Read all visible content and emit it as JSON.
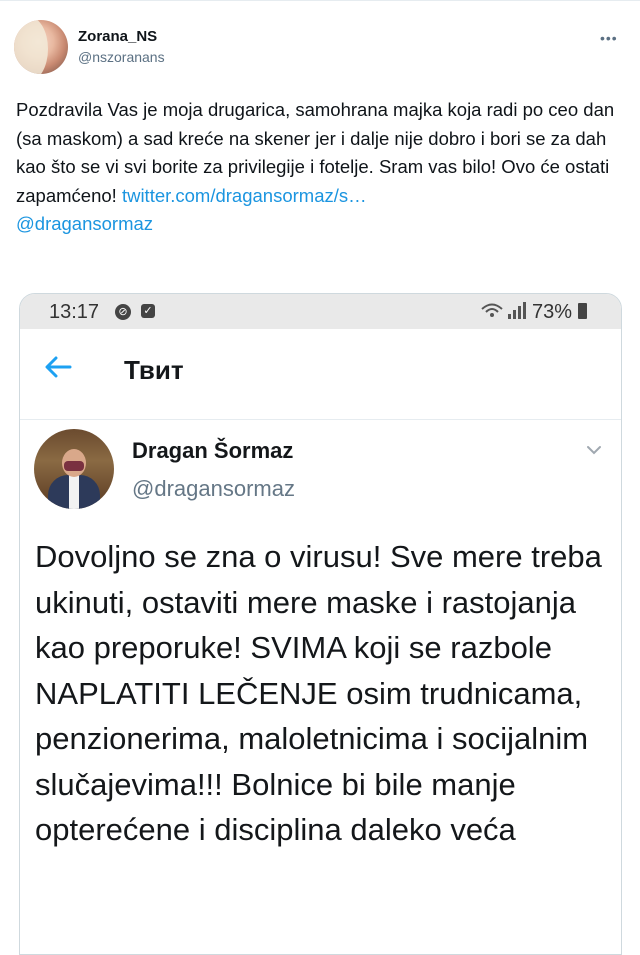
{
  "tweet": {
    "author_name": "Zorana_NS",
    "author_handle": "@nszoranans",
    "more_icon": "more-dots-icon",
    "text": "Pozdravila Vas je moja drugarica, samohrana majka koja radi po ceo dan (sa maskom) a sad kreće na skener jer i dalje nije dobro i bori se za dah kao što se vi svi borite za privilegije i fotelje. Sram vas bilo! Ovo će ostati zapamćeno! ",
    "link_text": "twitter.com/dragansormaz/s…",
    "mention": "@dragansormaz",
    "link_color": "#1b95e0"
  },
  "screenshot": {
    "status_bar": {
      "time": "13:17",
      "battery": "73%"
    },
    "header": {
      "title": "Твит"
    },
    "quoted_tweet": {
      "author_name": "Dragan Šormaz",
      "author_handle": "@dragansormaz",
      "text": "Dovoljno se zna o virusu! Sve mere treba ukinuti,  ostaviti mere maske i rastojanja kao preporuke! SVIMA koji se razbole NAPLATITI LEČENJE osim trudnicama, penzionerima, maloletnicima i socijalnim slučajevima!!! Bolnice bi bile manje opterećene i disciplina daleko veća"
    }
  }
}
